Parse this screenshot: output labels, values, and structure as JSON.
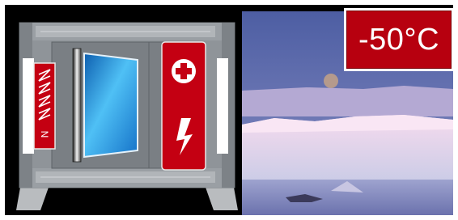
{
  "badge": {
    "temperature": "-50°C",
    "color": "#b7000f"
  },
  "unit": {
    "heater_label": "N",
    "plus_icon": "plus-icon",
    "power_icon": "lightning-icon"
  },
  "colors": {
    "panel_red": "#c40012",
    "glass_blue": "#1ea0e6",
    "cabinet_gray": "#8a8f94",
    "sky_blue": "#5d6aa8",
    "ice_pink": "#f1d6ea"
  }
}
